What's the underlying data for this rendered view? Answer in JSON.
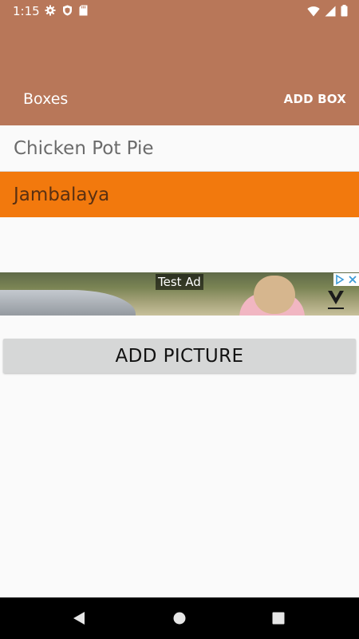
{
  "status_bar": {
    "time": "1:15",
    "left_icons": [
      "gear-icon",
      "shield-icon",
      "sd-card-icon"
    ],
    "right_icons": [
      "wifi-icon",
      "signal-icon",
      "battery-icon"
    ]
  },
  "toolbar": {
    "title": "Boxes",
    "action_label": "ADD BOX",
    "color": "#b87759"
  },
  "list": {
    "items": [
      {
        "label": "Chicken Pot Pie",
        "selected": false
      },
      {
        "label": "Jambalaya",
        "selected": true
      }
    ],
    "selected_color": "#f2790d"
  },
  "ad": {
    "label": "Test Ad",
    "icons": [
      "adchoices-icon",
      "close-icon",
      "brand-logo-icon"
    ]
  },
  "add_picture_button": {
    "label": "ADD PICTURE"
  },
  "nav_bar": {
    "icons": [
      "back-icon",
      "home-icon",
      "recents-icon"
    ]
  }
}
